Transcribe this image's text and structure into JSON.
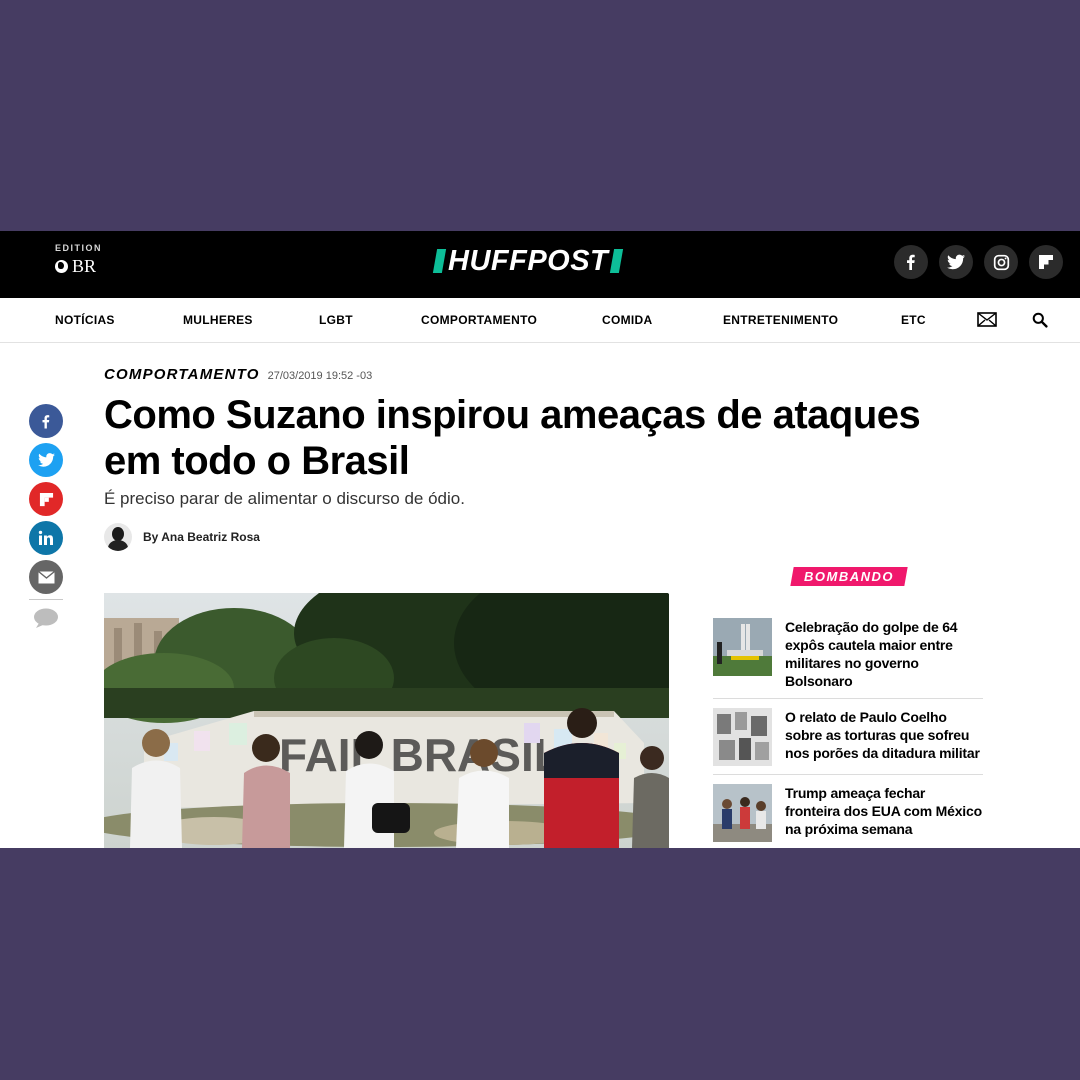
{
  "header": {
    "edition_label": "EDITION",
    "edition_code": "BR",
    "logo_text": "HUFFPOST",
    "socials": [
      "facebook-icon",
      "twitter-icon",
      "instagram-icon",
      "flipboard-icon"
    ]
  },
  "nav": {
    "items": [
      "NOTÍCIAS",
      "MULHERES",
      "LGBT",
      "COMPORTAMENTO",
      "COMIDA",
      "ENTRETENIMENTO",
      "ETC"
    ],
    "icons": [
      "mail-icon",
      "search-icon"
    ]
  },
  "share": {
    "buttons": [
      "facebook-icon",
      "twitter-icon",
      "flipboard-icon",
      "linkedin-icon",
      "email-icon",
      "comment-icon"
    ]
  },
  "article": {
    "section": "COMPORTAMENTO",
    "timestamp": "27/03/2019 19:52 -03",
    "headline": "Como Suzano inspirou ameaças de ataques em todo o Brasil",
    "subhead": "É preciso parar de alimentar o discurso de ódio.",
    "byline": "By Ana Beatriz Rosa"
  },
  "sidebar": {
    "label": "BOMBANDO",
    "items": [
      {
        "title": "Celebração do golpe de 64 expôs cautela maior entre militares no governo Bolsonaro"
      },
      {
        "title": "O relato de Paulo Coelho sobre as torturas que sofreu nos porões da ditadura militar"
      },
      {
        "title": "Trump ameaça fechar fronteira dos EUA com México na próxima semana"
      }
    ]
  },
  "colors": {
    "background": "#463c62",
    "logo_accent": "#0dbe98",
    "bombando": "#f0186c",
    "facebook": "#3b5998",
    "twitter": "#1da1f2",
    "flipboard": "#e12828",
    "linkedin": "#0e76a8",
    "email": "#666666"
  }
}
